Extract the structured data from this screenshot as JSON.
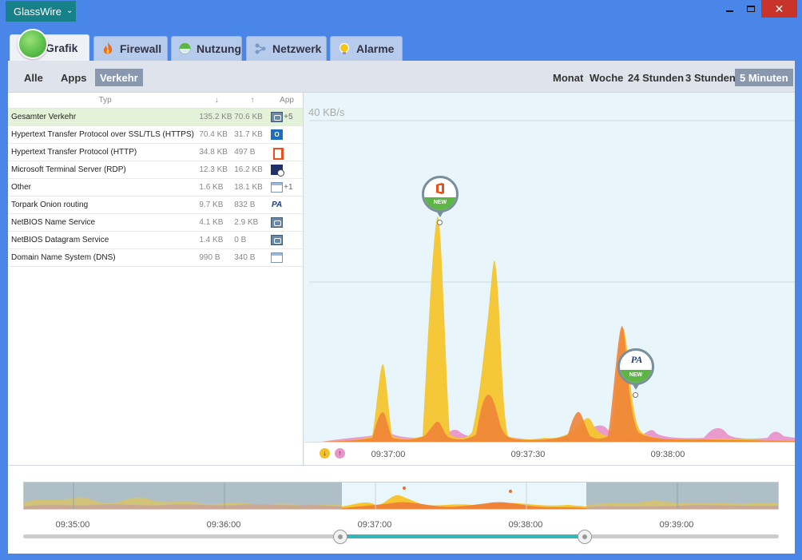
{
  "app": {
    "menu_label": "GlassWire"
  },
  "tabs": [
    {
      "label": "Grafik",
      "active": true
    },
    {
      "label": "Firewall"
    },
    {
      "label": "Nutzung"
    },
    {
      "label": "Netzwerk"
    },
    {
      "label": "Alarme"
    }
  ],
  "subnav": {
    "filters": [
      "Alle",
      "Apps",
      "Verkehr"
    ],
    "selected_filter": "Verkehr",
    "ranges": [
      "Monat",
      "Woche",
      "24 Stunden",
      "3 Stunden",
      "5 Minuten"
    ],
    "selected_range": "5 Minuten"
  },
  "table": {
    "headers": {
      "typ": "Typ",
      "down": "↓",
      "up": "↑",
      "app": "App"
    },
    "rows": [
      {
        "typ": "Gesamter Verkehr",
        "down": "135.2 KB",
        "up": "70.6 KB",
        "icon": "network-icon",
        "extra": "+5",
        "highlight": true
      },
      {
        "typ": "Hypertext Transfer Protocol over SSL/TLS (HTTPS)",
        "down": "70.4 KB",
        "up": "31.7 KB",
        "icon": "outlook-icon",
        "extra": ""
      },
      {
        "typ": "Hypertext Transfer Protocol (HTTP)",
        "down": "34.8 KB",
        "up": "497 B",
        "icon": "office-icon",
        "extra": ""
      },
      {
        "typ": "Microsoft Terminal Server (RDP)",
        "down": "12.3 KB",
        "up": "16.2 KB",
        "icon": "remote-desktop-icon",
        "extra": ""
      },
      {
        "typ": "Other",
        "down": "1.6 KB",
        "up": "18.1 KB",
        "icon": "window-icon",
        "extra": "+1"
      },
      {
        "typ": "Torpark Onion routing",
        "down": "9.7 KB",
        "up": "832 B",
        "icon": "pa-icon",
        "extra": ""
      },
      {
        "typ": "NetBIOS Name Service",
        "down": "4.1 KB",
        "up": "2.9 KB",
        "icon": "network-icon",
        "extra": ""
      },
      {
        "typ": "NetBIOS Datagram Service",
        "down": "1.4 KB",
        "up": "0 B",
        "icon": "network-icon",
        "extra": ""
      },
      {
        "typ": "Domain Name System (DNS)",
        "down": "990 B",
        "up": "340 B",
        "icon": "window-icon",
        "extra": ""
      }
    ]
  },
  "chart": {
    "scale_label": "40 KB/s",
    "x_ticks": [
      "09:37:00",
      "09:37:30",
      "09:38:00"
    ],
    "pins": [
      {
        "badge": "NEW",
        "app_icon": "office-icon"
      },
      {
        "badge": "NEW",
        "app_icon": "pa-icon",
        "logo_text": "PA"
      }
    ],
    "colors": {
      "download": "#f4c12e",
      "upload": "#e36fb3",
      "combined": "#ef8a3a"
    }
  },
  "overview": {
    "ticks": [
      "09:35:00",
      "09:36:00",
      "09:37:00",
      "09:38:00",
      "09:39:00"
    ],
    "selection": {
      "start": "09:37:00",
      "end": "09:38:00"
    }
  }
}
